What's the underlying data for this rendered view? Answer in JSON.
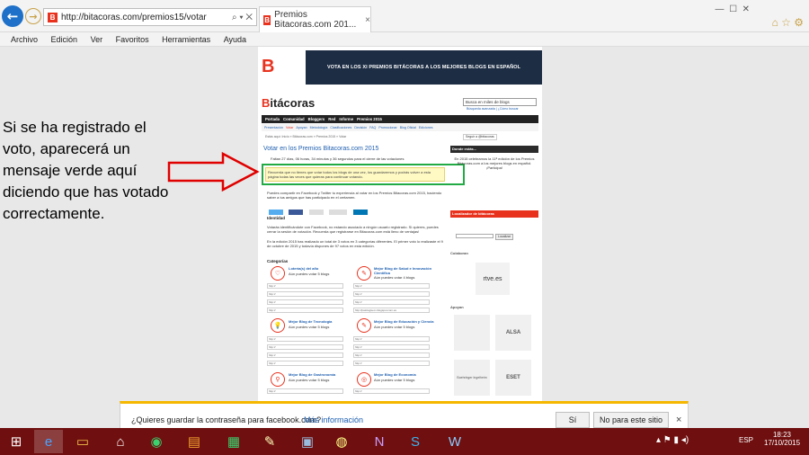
{
  "browser": {
    "address": "http://bitacoras.com/premios15/votar",
    "tab_title": "Premios Bitacoras.com 201...",
    "menu": [
      "Archivo",
      "Edición",
      "Ver",
      "Favoritos",
      "Herramientas",
      "Ayuda"
    ]
  },
  "page": {
    "banner_text": "VOTA EN LOS XI PREMIOS BITÁCORAS A LOS MEJORES BLOGS EN ESPAÑOL",
    "logo": "itácoras",
    "search_placeholder": "Busca en miles de blogs",
    "search_sub": "Búsqueda avanzada  |  ¿Cómo buscar",
    "nav": [
      "Portada",
      "Comunidad",
      "Bloggers",
      "Red",
      "Informe",
      "Premios 2015"
    ],
    "subnav": [
      "Presentación",
      "Votar",
      "Apoyan",
      "Metodología",
      "Clasificaciones",
      "Decisión",
      "FAQ",
      "Promocionar",
      "Blog Oficial",
      "Ediciones"
    ],
    "subnav_right": "Seguir a @bitacoras",
    "breadcrumb": "Estás aquí: Inicio » Bitácoras.com » Premios 2015 » Votar",
    "title": "Votar en los Premios Bitacoras.com 2015",
    "countdown": "Faltan 27 días, 06 horas, 34 minutos y 36 segundos para el cierre de las votaciones",
    "notice": "Recuerda que no tienes que votar todos los blogs de una vez, los guardaremos y podrás volver a esta página todas las veces que quieras para continuar votando.",
    "share_text": "Puedes compartir en Facebook y Twitter tu experiencia al votar en los Premios Bitacoras.com 2015, haciendo saber a tus amigos que has participado en el certamen.",
    "section_identity": "Identidad",
    "identity_text": "Votarás identificándote con Facebook, no estando asociado a ningún usuario registrado. Si quieres, puedes cerrar la sesión de votación. Recuerda que registrarse en Bitacoras.com está lleno de ventajas!",
    "edition_text": "En la edición 2015 has realizado un total de 3 votos en 3 categorías diferentes. El primer voto lo realizaste el 9 de octubre de 2015 y todavía dispones de 97 votos en esta edición.",
    "section_categories": "Categorías",
    "categories": [
      {
        "name": "Lotería(s) del año",
        "sub": "Aún puedes votar 5 blogs"
      },
      {
        "name": "Mejor Blog de Salud e Innovación Científica",
        "sub": "Aún puedes votar 4 blogs"
      },
      {
        "name": "Mejor Blog de Tecnología",
        "sub": "Aún puedes votar 5 blogs"
      },
      {
        "name": "Mejor Blog de Educación y Ciencia",
        "sub": "Aún puedes votar 5 blogs"
      },
      {
        "name": "Mejor Blog de Gastronomía",
        "sub": "Aún puedes votar 5 blogs"
      },
      {
        "name": "Mejor Blog de Economía",
        "sub": "Aún puedes votar 5 blogs"
      }
    ],
    "input_value": "http://",
    "filled_value": "http://patologia-m-blogspot.com.es",
    "side_donde": "Donde estás...",
    "side_donde_text": "En 2015 celebramos la 11ª edición de los Premios Bitácoras.com a los mejores blogs en español. ¡Participa!",
    "side_locator": "Localizador de bitácoras",
    "side_locator_btn": "Localizar",
    "side_colaboran": "Colaboran",
    "side_apoyan": "Apoyan",
    "logos": [
      "rtve.es",
      "ALSA",
      "Boehringer Ingelheim",
      "ESET"
    ]
  },
  "annotation": "Si se ha registrado el voto, aparecerá un mensaje verde aquí diciendo que has votado correctamente.",
  "password_bar": {
    "question": "¿Quieres guardar la contraseña para facebook.com?",
    "more": "Más información",
    "yes": "Sí",
    "no": "No para este sitio"
  },
  "taskbar": {
    "lang": "ESP",
    "time": "18:23",
    "date": "17/10/2015"
  },
  "colors": {
    "brand": "#e8321e",
    "banner": "#1d2d44",
    "taskbar": "#6f0f0f",
    "highlight": "#22aa44",
    "arrow": "#e00000"
  }
}
